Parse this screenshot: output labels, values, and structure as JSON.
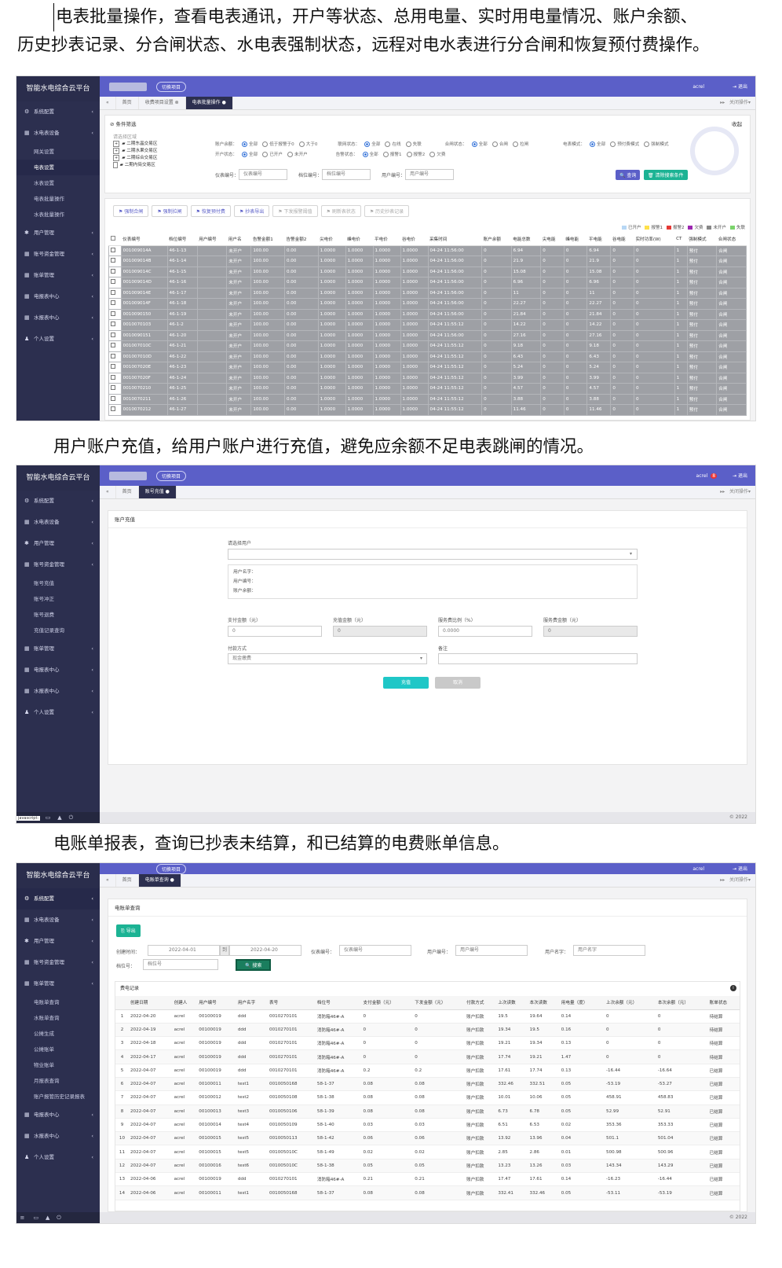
{
  "para1": {
    "line1": "电表批量操作，查看电表通讯，开户等状态、总用电量、实时用电量情况、账户余额、",
    "line2": "历史抄表记录、分合闸状态、水电表强制状态，远程对电水表进行分合闸和恢复预付费操作。"
  },
  "para2": "用户账户充值，给用户账户进行充值，避免应余额不足电表跳闸的情况。",
  "para3": "电账单报表，查询已抄表未结算，和已结算的电费账单信息。",
  "common": {
    "app_title": "智能水电综合云平台",
    "switch_project": "切换项目",
    "user": "acrel",
    "logout": "退出",
    "home": "首页",
    "close_ops": "关闭操作",
    "copyright": "© 2022"
  },
  "s1": {
    "nav": [
      "系统配置",
      "水电表设备",
      "网关设置",
      "电表设置",
      "水表设置",
      "电表批量操作",
      "水表批量操作",
      "用户管理",
      "账号资金管理",
      "账单管理",
      "电报表中心",
      "水报表中心",
      "个人设置"
    ],
    "tabs": [
      "收费项目设置",
      "电表批量操作"
    ],
    "filter_title": "条件筛选",
    "collapse": "收起",
    "area_label": "请选择区域",
    "tree": [
      "二期东晶交易区",
      "二期水果交易区",
      "二期综合交易区",
      "二期内街交易区"
    ],
    "row1": {
      "balance": "账户余额：",
      "opts1": [
        "全部",
        "低于报警于0",
        "大于0"
      ],
      "link": "联网状态：",
      "opts2": [
        "全部",
        "在线",
        "失联"
      ],
      "switch": "合闸状态：",
      "opts3": [
        "全部",
        "合闸",
        "拉闸"
      ],
      "mode": "电表模式：",
      "opts4": [
        "全部",
        "预付费模式",
        "强制模式"
      ]
    },
    "row2": {
      "open": "开户状态：",
      "opts1": [
        "全部",
        "已开户",
        "未开户"
      ],
      "alarm": "告警状态：",
      "opts2": [
        "全部",
        "报警1",
        "报警2",
        "欠费"
      ]
    },
    "row3": {
      "meter": "仪表编号：",
      "meter_ph": "仪表编号",
      "slot": "档位编号：",
      "slot_ph": "档位编号",
      "user": "用户编号：",
      "user_ph": "用户编号"
    },
    "query": "查询",
    "clear": "清除搜索条件",
    "ops": [
      "强制合闸",
      "强制拉闸",
      "恢复预付费",
      "抄表导出",
      "下发报警阈值",
      "刷新表状态",
      "历史抄表记录"
    ],
    "legend": [
      "已开户",
      "报警1",
      "报警2",
      "欠费",
      "未开户",
      "失联"
    ],
    "headers": [
      "仪表编号",
      "档位编号",
      "用户编号",
      "用户名",
      "告警金额1",
      "告警金额2",
      "尖电价",
      "峰电价",
      "平电价",
      "谷电价",
      "采集时间",
      "账户余额",
      "电能总数",
      "尖电能",
      "峰电能",
      "平电能",
      "谷电能",
      "实时功率(W)",
      "CT",
      "强制模式",
      "合闸状态"
    ],
    "rows": [
      [
        "001009014A",
        "46-1-13",
        "",
        "未开户",
        "100.00",
        "0.00",
        "1.0000",
        "1.0000",
        "1.0000",
        "1.0000",
        "04-24 11:56:00",
        "0",
        "6.94",
        "0",
        "0",
        "6.94",
        "0",
        "0",
        "1",
        "预付",
        "合闸"
      ],
      [
        "001009014B",
        "46-1-14",
        "",
        "未开户",
        "100.00",
        "0.00",
        "1.0000",
        "1.0000",
        "1.0000",
        "1.0000",
        "04-24 11:56:00",
        "0",
        "21.9",
        "0",
        "0",
        "21.9",
        "0",
        "0",
        "1",
        "预付",
        "合闸"
      ],
      [
        "001009014C",
        "46-1-15",
        "",
        "未开户",
        "100.00",
        "0.00",
        "1.0000",
        "1.0000",
        "1.0000",
        "1.0000",
        "04-24 11:56:00",
        "0",
        "15.08",
        "0",
        "0",
        "15.08",
        "0",
        "0",
        "1",
        "预付",
        "合闸"
      ],
      [
        "001009014D",
        "46-1-16",
        "",
        "未开户",
        "100.00",
        "0.00",
        "1.0000",
        "1.0000",
        "1.0000",
        "1.0000",
        "04-24 11:56:00",
        "0",
        "6.96",
        "0",
        "0",
        "6.96",
        "0",
        "0",
        "1",
        "预付",
        "合闸"
      ],
      [
        "001009014E",
        "46-1-17",
        "",
        "未开户",
        "100.00",
        "0.00",
        "1.0000",
        "1.0000",
        "1.0000",
        "1.0000",
        "04-24 11:56:00",
        "0",
        "11",
        "0",
        "0",
        "11",
        "0",
        "0",
        "1",
        "预付",
        "合闸"
      ],
      [
        "001009014F",
        "46-1-18",
        "",
        "未开户",
        "100.00",
        "0.00",
        "1.0000",
        "1.0000",
        "1.0000",
        "1.0000",
        "04-24 11:56:00",
        "0",
        "22.27",
        "0",
        "0",
        "22.27",
        "0",
        "0",
        "1",
        "预付",
        "合闸"
      ],
      [
        "0010090150",
        "46-1-19",
        "",
        "未开户",
        "100.00",
        "0.00",
        "1.0000",
        "1.0000",
        "1.0000",
        "1.0000",
        "04-24 11:56:00",
        "0",
        "21.84",
        "0",
        "0",
        "21.84",
        "0",
        "0",
        "1",
        "预付",
        "合闸"
      ],
      [
        "0010070103",
        "46-1-2",
        "",
        "未开户",
        "100.00",
        "0.00",
        "1.0000",
        "1.0000",
        "1.0000",
        "1.0000",
        "04-24 11:55:12",
        "0",
        "14.22",
        "0",
        "0",
        "14.22",
        "0",
        "0",
        "1",
        "预付",
        "合闸"
      ],
      [
        "0010090151",
        "46-1-20",
        "",
        "未开户",
        "100.00",
        "0.00",
        "1.0000",
        "1.0000",
        "1.0000",
        "1.0000",
        "04-24 11:56:00",
        "0",
        "27.16",
        "0",
        "0",
        "27.16",
        "0",
        "0",
        "1",
        "预付",
        "合闸"
      ],
      [
        "001007010C",
        "46-1-21",
        "",
        "未开户",
        "100.00",
        "0.00",
        "1.0000",
        "1.0000",
        "1.0000",
        "1.0000",
        "04-24 11:55:12",
        "0",
        "9.18",
        "0",
        "0",
        "9.18",
        "0",
        "0",
        "1",
        "预付",
        "合闸"
      ],
      [
        "001007010D",
        "46-1-22",
        "",
        "未开户",
        "100.00",
        "0.00",
        "1.0000",
        "1.0000",
        "1.0000",
        "1.0000",
        "04-24 11:55:12",
        "0",
        "6.43",
        "0",
        "0",
        "6.43",
        "0",
        "0",
        "1",
        "预付",
        "合闸"
      ],
      [
        "001007020E",
        "46-1-23",
        "",
        "未开户",
        "100.00",
        "0.00",
        "1.0000",
        "1.0000",
        "1.0000",
        "1.0000",
        "04-24 11:55:12",
        "0",
        "5.24",
        "0",
        "0",
        "5.24",
        "0",
        "0",
        "1",
        "预付",
        "合闸"
      ],
      [
        "001007020F",
        "46-1-24",
        "",
        "未开户",
        "100.00",
        "0.00",
        "1.0000",
        "1.0000",
        "1.0000",
        "1.0000",
        "04-24 11:55:12",
        "0",
        "3.99",
        "0",
        "0",
        "3.99",
        "0",
        "0",
        "1",
        "预付",
        "合闸"
      ],
      [
        "0010070210",
        "46-1-25",
        "",
        "未开户",
        "100.00",
        "0.00",
        "1.0000",
        "1.0000",
        "1.0000",
        "1.0000",
        "04-24 11:55:12",
        "0",
        "4.57",
        "0",
        "0",
        "4.57",
        "0",
        "0",
        "1",
        "预付",
        "合闸"
      ],
      [
        "0010070211",
        "46-1-26",
        "",
        "未开户",
        "100.00",
        "0.00",
        "1.0000",
        "1.0000",
        "1.0000",
        "1.0000",
        "04-24 11:55:12",
        "0",
        "3.88",
        "0",
        "0",
        "3.88",
        "0",
        "0",
        "1",
        "预付",
        "合闸"
      ],
      [
        "0010070212",
        "46-1-27",
        "",
        "未开户",
        "100.00",
        "0.00",
        "1.0000",
        "1.0000",
        "1.0000",
        "1.0000",
        "04-24 11:55:12",
        "0",
        "11.46",
        "0",
        "0",
        "11.46",
        "0",
        "0",
        "1",
        "预付",
        "合闸"
      ]
    ]
  },
  "s2": {
    "nav": [
      "系统配置",
      "水电表设备",
      "用户管理",
      "账号资金管理",
      "账号充值",
      "账号冲正",
      "账号退费",
      "充值记录查询",
      "账单管理",
      "电报表中心",
      "水报表中心",
      "个人设置"
    ],
    "tab": "账号充值",
    "panel_title": "账户充值",
    "select_user": "请选择用户",
    "info": [
      "用户名字：",
      "用户编号：",
      "账户余额："
    ],
    "f": {
      "pay": "支付金额（元）",
      "pay_v": "0",
      "charge": "充值金额（元）",
      "charge_v": "0",
      "rate": "服务费比例（%）",
      "rate_v": "0.0000",
      "fee": "服务费金额（元）",
      "fee_v": "0",
      "method": "付款方式",
      "method_v": "现金缴费",
      "remark": "备注"
    },
    "ok": "充值",
    "cancel": "取消",
    "js": "javascript:"
  },
  "s3": {
    "nav": [
      "系统配置",
      "水电表设备",
      "用户管理",
      "账号资金管理",
      "账单管理",
      "电账单查询",
      "水账单查询",
      "公摊生成",
      "公摊账单",
      "物业账单",
      "月报表查询",
      "账户报管历史记录报表",
      "电报表中心",
      "水报表中心",
      "个人设置"
    ],
    "tab": "电账单查询",
    "panel_title": "电账单查询",
    "export": "导出",
    "created": "创建时间：",
    "d1": "2022-04-01",
    "to": "到",
    "d2": "2022-04-20",
    "meter": "仪表编号：",
    "meter_ph": "仪表编号",
    "uno": "用户编号：",
    "uno_ph": "用户编号",
    "uname": "用户名字：",
    "uname_ph": "用户名字",
    "slot": "档位号：",
    "slot_ph": "档位号",
    "search": "搜索",
    "records": "费电记录",
    "headers": [
      "",
      "创建日期",
      "创建人",
      "用户编号",
      "用户名字",
      "表号",
      "档位号",
      "支付金额（元）",
      "下发金额（元）",
      "付款方式",
      "上次读数",
      "本次读数",
      "用电量（度）",
      "上次余额（元）",
      "本次余额（元）",
      "账单状态"
    ],
    "rows": [
      [
        "1",
        "2022-04-20",
        "acrel",
        "00100019",
        "ddd",
        "0010270101",
        "消防箱46#-A",
        "0",
        "0",
        "账户扣款",
        "19.5",
        "19.64",
        "0.14",
        "0",
        "0",
        "待结算"
      ],
      [
        "2",
        "2022-04-19",
        "acrel",
        "00100019",
        "ddd",
        "0010270101",
        "消防箱46#-A",
        "0",
        "0",
        "账户扣款",
        "19.34",
        "19.5",
        "0.16",
        "0",
        "0",
        "待结算"
      ],
      [
        "3",
        "2022-04-18",
        "acrel",
        "00100019",
        "ddd",
        "0010270101",
        "消防箱46#-A",
        "0",
        "0",
        "账户扣款",
        "19.21",
        "19.34",
        "0.13",
        "0",
        "0",
        "待结算"
      ],
      [
        "4",
        "2022-04-17",
        "acrel",
        "00100019",
        "ddd",
        "0010270101",
        "消防箱46#-A",
        "0",
        "0",
        "账户扣款",
        "17.74",
        "19.21",
        "1.47",
        "0",
        "0",
        "待结算"
      ],
      [
        "5",
        "2022-04-07",
        "acrel",
        "00100019",
        "ddd",
        "0010270101",
        "消防箱46#-A",
        "0.2",
        "0.2",
        "账户扣款",
        "17.61",
        "17.74",
        "0.13",
        "-16.44",
        "-16.64",
        "已结算"
      ],
      [
        "6",
        "2022-04-07",
        "acrel",
        "00100011",
        "test1",
        "0010050168",
        "58-1-37",
        "0.08",
        "0.08",
        "账户扣款",
        "332.46",
        "332.51",
        "0.05",
        "-53.19",
        "-53.27",
        "已结算"
      ],
      [
        "7",
        "2022-04-07",
        "acrel",
        "00100012",
        "test2",
        "0010050108",
        "58-1-38",
        "0.08",
        "0.08",
        "账户扣款",
        "10.01",
        "10.06",
        "0.05",
        "458.91",
        "458.83",
        "已结算"
      ],
      [
        "8",
        "2022-04-07",
        "acrel",
        "00100013",
        "test3",
        "0010050106",
        "58-1-39",
        "0.08",
        "0.08",
        "账户扣款",
        "6.73",
        "6.78",
        "0.05",
        "52.99",
        "52.91",
        "已结算"
      ],
      [
        "9",
        "2022-04-07",
        "acrel",
        "00100014",
        "test4",
        "0010050109",
        "58-1-40",
        "0.03",
        "0.03",
        "账户扣款",
        "6.51",
        "6.53",
        "0.02",
        "353.36",
        "353.33",
        "已结算"
      ],
      [
        "10",
        "2022-04-07",
        "acrel",
        "00100015",
        "test5",
        "0010050113",
        "58-1-42",
        "0.06",
        "0.06",
        "账户扣款",
        "13.92",
        "13.96",
        "0.04",
        "501.1",
        "501.04",
        "已结算"
      ],
      [
        "11",
        "2022-04-07",
        "acrel",
        "00100015",
        "test5",
        "001005010C",
        "58-1-49",
        "0.02",
        "0.02",
        "账户扣款",
        "2.85",
        "2.86",
        "0.01",
        "500.98",
        "500.96",
        "已结算"
      ],
      [
        "12",
        "2022-04-07",
        "acrel",
        "00100016",
        "test6",
        "001005010C",
        "58-1-38",
        "0.05",
        "0.05",
        "账户扣款",
        "13.23",
        "13.26",
        "0.03",
        "143.34",
        "143.29",
        "已结算"
      ],
      [
        "13",
        "2022-04-06",
        "acrel",
        "00100019",
        "ddd",
        "0010270101",
        "消防箱46#-A",
        "0.21",
        "0.21",
        "账户扣款",
        "17.47",
        "17.61",
        "0.14",
        "-16.23",
        "-16.44",
        "已结算"
      ],
      [
        "14",
        "2022-04-06",
        "acrel",
        "00100011",
        "test1",
        "0010050168",
        "58-1-37",
        "0.08",
        "0.08",
        "账户扣款",
        "332.41",
        "332.46",
        "0.05",
        "-53.11",
        "-53.19",
        "已结算"
      ]
    ]
  }
}
